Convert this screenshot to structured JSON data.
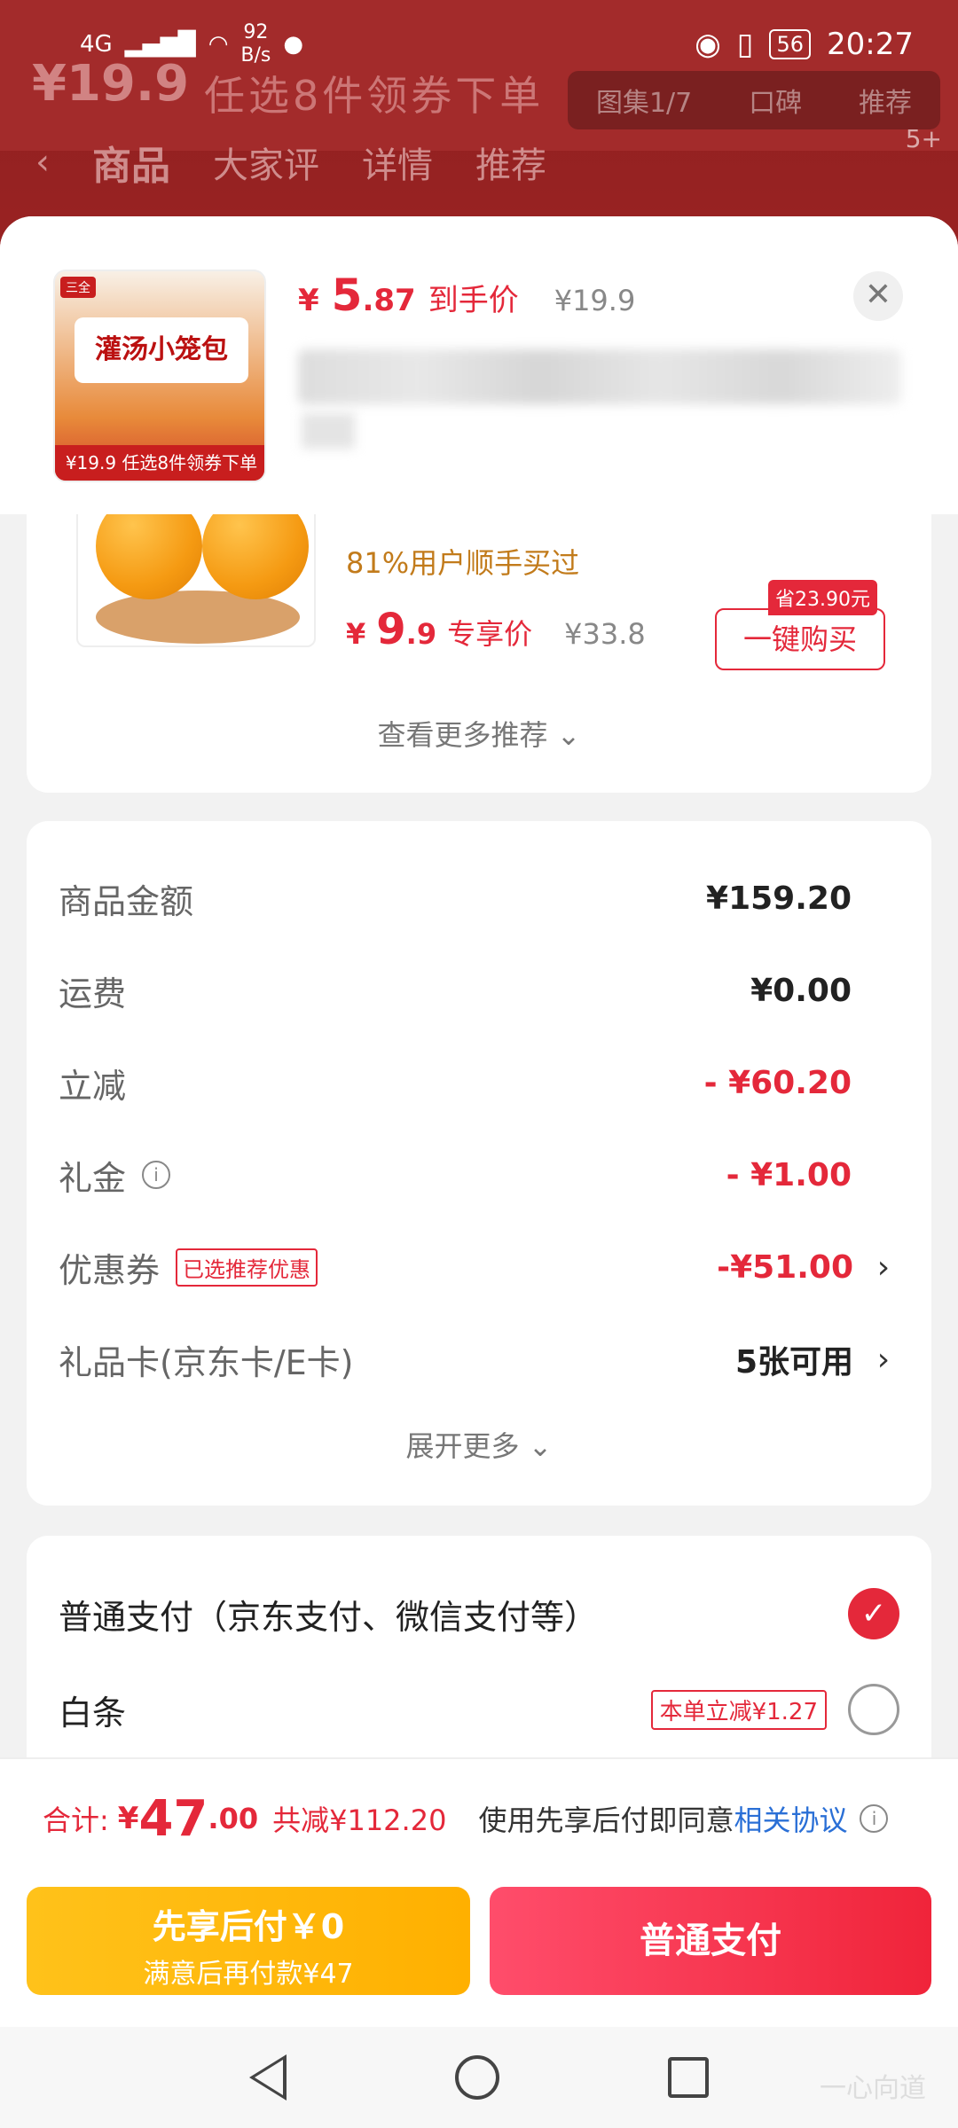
{
  "status_bar": {
    "network": "4G",
    "speed": "92",
    "speed_unit": "B/s",
    "battery": "56",
    "time": "20:27"
  },
  "background": {
    "banner_price": "¥19.9",
    "banner_text": "任选8件领券下单",
    "gallery": [
      "图集1/7",
      "口碑",
      "推荐"
    ],
    "nav": [
      "商品",
      "大家评",
      "详情",
      "推荐"
    ],
    "badge": "5+"
  },
  "sheet_header": {
    "price_symbol": "¥",
    "price_int": "5",
    "price_dec": ".87",
    "price_tail": "到手价",
    "original_price": "¥19.9",
    "thumbnail_title": "灌汤小笼包",
    "thumbnail_strip": "任选8件领券下单",
    "thumbnail_price": "¥19.9",
    "close_icon": "close-icon"
  },
  "recommendation": {
    "buy_rate": "81%用户顺手买过",
    "price_symbol": "¥",
    "price_int": "9",
    "price_dec": ".9",
    "price_tail": "专享价",
    "original_price": "¥33.8",
    "save_tag": "省23.90元",
    "buy_button": "一键购买",
    "more_label": "查看更多推荐 ⌄"
  },
  "amounts": {
    "rows": [
      {
        "label": "商品金额",
        "value": "¥159.20"
      },
      {
        "label": "运费",
        "value": "¥0.00"
      },
      {
        "label": "立减",
        "value": "- ¥60.20"
      },
      {
        "label": "礼金",
        "value": "- ¥1.00"
      },
      {
        "label": "优惠券",
        "tag": "已选推荐优惠",
        "value": "-¥51.00"
      },
      {
        "label": "礼品卡(京东卡/E卡)",
        "value": "5张可用"
      }
    ],
    "expand_label": "展开更多 ⌄"
  },
  "payment": {
    "options": [
      {
        "label": "普通支付（京东支付、微信支付等）",
        "selected": true
      },
      {
        "label": "白条",
        "tag": "本单立减¥1.27",
        "selected": false
      }
    ]
  },
  "total": {
    "label": "合计:",
    "symbol": "¥",
    "int": "47",
    "dec": ".00",
    "saved": "共减¥112.20",
    "agree_text": "使用先享后付即同意",
    "agree_link": "相关协议"
  },
  "buttons": {
    "later_title": "先享后付￥0",
    "later_sub": "满意后再付款¥47",
    "pay": "普通支付"
  },
  "watermark": "一心向道",
  "colors": {
    "accent": "#e4283a",
    "gold": "#ffb000",
    "link": "#2a6fd6"
  }
}
